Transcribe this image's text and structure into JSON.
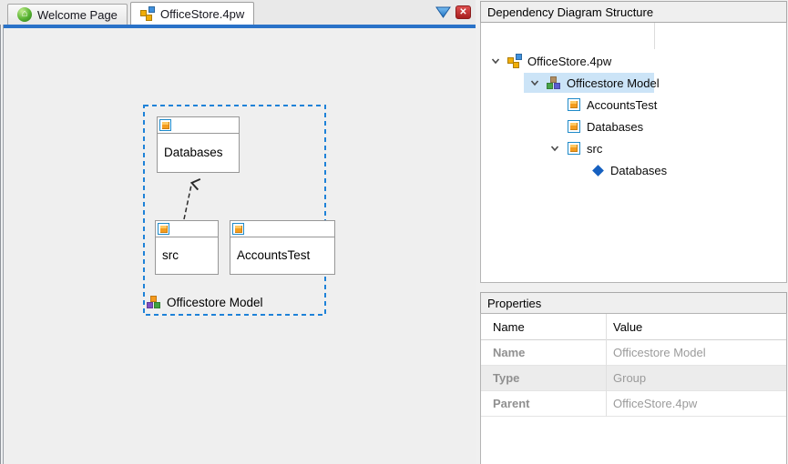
{
  "tabbar": {
    "tabs": [
      {
        "label": "Welcome Page"
      },
      {
        "label": "OfficeStore.4pw"
      }
    ]
  },
  "icons": {
    "home_glyph": "⌂",
    "close_glyph": "✕"
  },
  "canvas": {
    "group": {
      "label": "Officestore Model"
    },
    "nodes": [
      {
        "label": "Databases"
      },
      {
        "label": "src"
      },
      {
        "label": "AccountsTest"
      }
    ],
    "edge": {
      "from": "src",
      "to": "Databases",
      "style": "dashed-arrow"
    }
  },
  "structure_panel": {
    "title": "Dependency Diagram Structure",
    "tree": [
      {
        "label": "OfficeStore.4pw",
        "level": 0,
        "icon": "diagram-icon",
        "expanded": true
      },
      {
        "label": "Officestore Model",
        "level": 1,
        "icon": "cubes-icon",
        "expanded": true,
        "selected": true
      },
      {
        "label": "AccountsTest",
        "level": 2,
        "icon": "module-cube-icon"
      },
      {
        "label": "Databases",
        "level": 2,
        "icon": "module-cube-icon"
      },
      {
        "label": "src",
        "level": 2,
        "icon": "module-cube-icon",
        "expanded": true
      },
      {
        "label": "Databases",
        "level": 3,
        "icon": "dependency-diamond-icon"
      }
    ]
  },
  "properties_panel": {
    "title": "Properties",
    "columns": [
      "Name",
      "Value"
    ],
    "rows": [
      {
        "name": "Name",
        "value": "Officestore Model"
      },
      {
        "name": "Type",
        "value": "Group"
      },
      {
        "name": "Parent",
        "value": "OfficeStore.4pw"
      }
    ]
  },
  "colors": {
    "accent_blue": "#2a72c8",
    "selection_dash_blue": "#1e82d8",
    "tree_selection_bg": "#cce4f7",
    "close_red": "#a81f1f",
    "canvas_bg": "#efefef"
  }
}
